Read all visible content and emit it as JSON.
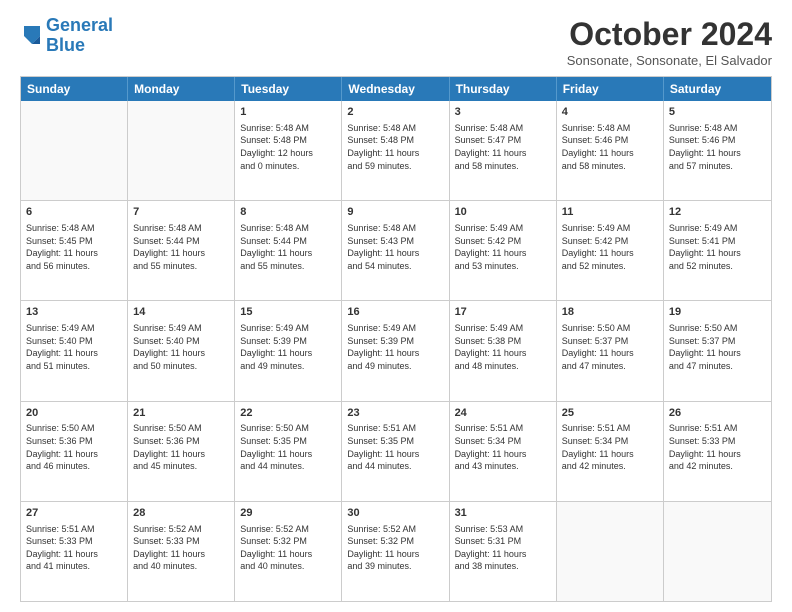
{
  "logo": {
    "line1": "General",
    "line2": "Blue"
  },
  "title": "October 2024",
  "subtitle": "Sonsonate, Sonsonate, El Salvador",
  "days": [
    "Sunday",
    "Monday",
    "Tuesday",
    "Wednesday",
    "Thursday",
    "Friday",
    "Saturday"
  ],
  "rows": [
    [
      {
        "day": "",
        "info": ""
      },
      {
        "day": "",
        "info": ""
      },
      {
        "day": "1",
        "info": "Sunrise: 5:48 AM\nSunset: 5:48 PM\nDaylight: 12 hours\nand 0 minutes."
      },
      {
        "day": "2",
        "info": "Sunrise: 5:48 AM\nSunset: 5:48 PM\nDaylight: 11 hours\nand 59 minutes."
      },
      {
        "day": "3",
        "info": "Sunrise: 5:48 AM\nSunset: 5:47 PM\nDaylight: 11 hours\nand 58 minutes."
      },
      {
        "day": "4",
        "info": "Sunrise: 5:48 AM\nSunset: 5:46 PM\nDaylight: 11 hours\nand 58 minutes."
      },
      {
        "day": "5",
        "info": "Sunrise: 5:48 AM\nSunset: 5:46 PM\nDaylight: 11 hours\nand 57 minutes."
      }
    ],
    [
      {
        "day": "6",
        "info": "Sunrise: 5:48 AM\nSunset: 5:45 PM\nDaylight: 11 hours\nand 56 minutes."
      },
      {
        "day": "7",
        "info": "Sunrise: 5:48 AM\nSunset: 5:44 PM\nDaylight: 11 hours\nand 55 minutes."
      },
      {
        "day": "8",
        "info": "Sunrise: 5:48 AM\nSunset: 5:44 PM\nDaylight: 11 hours\nand 55 minutes."
      },
      {
        "day": "9",
        "info": "Sunrise: 5:48 AM\nSunset: 5:43 PM\nDaylight: 11 hours\nand 54 minutes."
      },
      {
        "day": "10",
        "info": "Sunrise: 5:49 AM\nSunset: 5:42 PM\nDaylight: 11 hours\nand 53 minutes."
      },
      {
        "day": "11",
        "info": "Sunrise: 5:49 AM\nSunset: 5:42 PM\nDaylight: 11 hours\nand 52 minutes."
      },
      {
        "day": "12",
        "info": "Sunrise: 5:49 AM\nSunset: 5:41 PM\nDaylight: 11 hours\nand 52 minutes."
      }
    ],
    [
      {
        "day": "13",
        "info": "Sunrise: 5:49 AM\nSunset: 5:40 PM\nDaylight: 11 hours\nand 51 minutes."
      },
      {
        "day": "14",
        "info": "Sunrise: 5:49 AM\nSunset: 5:40 PM\nDaylight: 11 hours\nand 50 minutes."
      },
      {
        "day": "15",
        "info": "Sunrise: 5:49 AM\nSunset: 5:39 PM\nDaylight: 11 hours\nand 49 minutes."
      },
      {
        "day": "16",
        "info": "Sunrise: 5:49 AM\nSunset: 5:39 PM\nDaylight: 11 hours\nand 49 minutes."
      },
      {
        "day": "17",
        "info": "Sunrise: 5:49 AM\nSunset: 5:38 PM\nDaylight: 11 hours\nand 48 minutes."
      },
      {
        "day": "18",
        "info": "Sunrise: 5:50 AM\nSunset: 5:37 PM\nDaylight: 11 hours\nand 47 minutes."
      },
      {
        "day": "19",
        "info": "Sunrise: 5:50 AM\nSunset: 5:37 PM\nDaylight: 11 hours\nand 47 minutes."
      }
    ],
    [
      {
        "day": "20",
        "info": "Sunrise: 5:50 AM\nSunset: 5:36 PM\nDaylight: 11 hours\nand 46 minutes."
      },
      {
        "day": "21",
        "info": "Sunrise: 5:50 AM\nSunset: 5:36 PM\nDaylight: 11 hours\nand 45 minutes."
      },
      {
        "day": "22",
        "info": "Sunrise: 5:50 AM\nSunset: 5:35 PM\nDaylight: 11 hours\nand 44 minutes."
      },
      {
        "day": "23",
        "info": "Sunrise: 5:51 AM\nSunset: 5:35 PM\nDaylight: 11 hours\nand 44 minutes."
      },
      {
        "day": "24",
        "info": "Sunrise: 5:51 AM\nSunset: 5:34 PM\nDaylight: 11 hours\nand 43 minutes."
      },
      {
        "day": "25",
        "info": "Sunrise: 5:51 AM\nSunset: 5:34 PM\nDaylight: 11 hours\nand 42 minutes."
      },
      {
        "day": "26",
        "info": "Sunrise: 5:51 AM\nSunset: 5:33 PM\nDaylight: 11 hours\nand 42 minutes."
      }
    ],
    [
      {
        "day": "27",
        "info": "Sunrise: 5:51 AM\nSunset: 5:33 PM\nDaylight: 11 hours\nand 41 minutes."
      },
      {
        "day": "28",
        "info": "Sunrise: 5:52 AM\nSunset: 5:33 PM\nDaylight: 11 hours\nand 40 minutes."
      },
      {
        "day": "29",
        "info": "Sunrise: 5:52 AM\nSunset: 5:32 PM\nDaylight: 11 hours\nand 40 minutes."
      },
      {
        "day": "30",
        "info": "Sunrise: 5:52 AM\nSunset: 5:32 PM\nDaylight: 11 hours\nand 39 minutes."
      },
      {
        "day": "31",
        "info": "Sunrise: 5:53 AM\nSunset: 5:31 PM\nDaylight: 11 hours\nand 38 minutes."
      },
      {
        "day": "",
        "info": ""
      },
      {
        "day": "",
        "info": ""
      }
    ]
  ]
}
